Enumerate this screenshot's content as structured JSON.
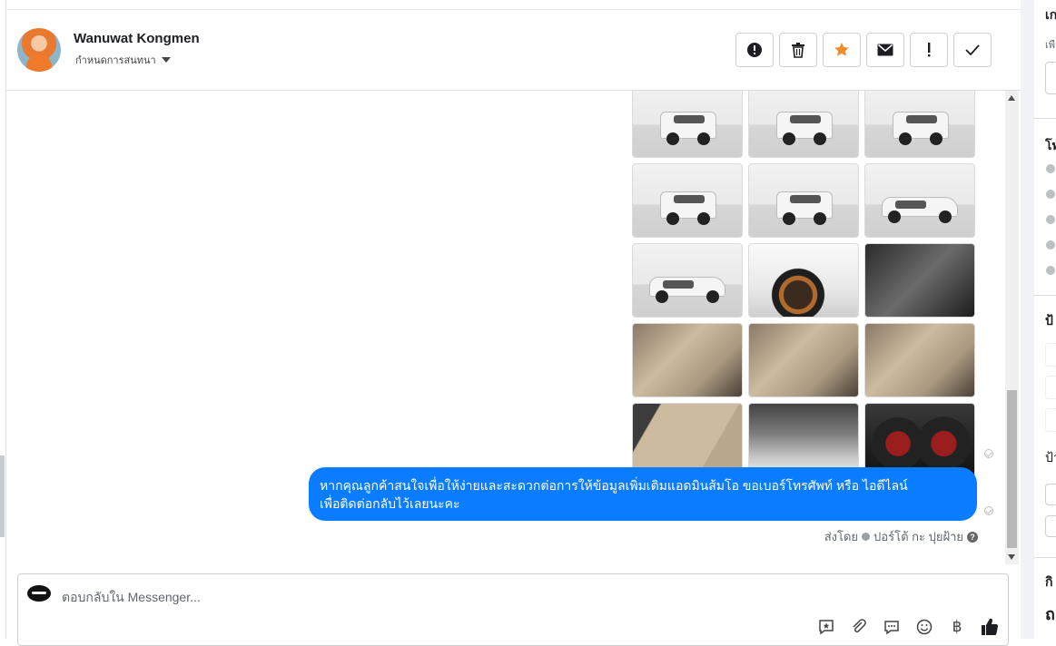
{
  "header": {
    "name": "Wanuwat Kongmen",
    "subtitle": "กำหนดการสนทนา",
    "actions": [
      {
        "name": "spam-button",
        "icon": "alert-circle-icon"
      },
      {
        "name": "delete-button",
        "icon": "trash-icon"
      },
      {
        "name": "star-button",
        "icon": "star-icon",
        "color": "#f28c28"
      },
      {
        "name": "mark-unread-button",
        "icon": "envelope-icon"
      },
      {
        "name": "important-button",
        "icon": "exclamation-icon"
      },
      {
        "name": "done-button",
        "icon": "checkmark-icon"
      }
    ]
  },
  "photos": [
    "showroom",
    "showroom",
    "showroom",
    "showroom",
    "showroom",
    "showroom",
    "showroom-side",
    "wheel",
    "dark",
    "interior",
    "interior",
    "interior",
    "door",
    "engine",
    "gauge"
  ],
  "message": {
    "text_line1": "หากคุณลูกค้าสนใจเพื่อให้ง่ายและสะดวกต่อการให้ข้อมูลเพิ่มเติมแอดมินส้มโอ ขอเบอร์โทรศัพท์ หรือ ไอดีไลน์",
    "text_line2": "เพื่อติดต่อกลับไว้เลยนะคะ",
    "bubble_color": "#0a7cff",
    "sent_by_prefix": "ส่งโดย",
    "sent_by_name": "ปอร์โต้ กะ ปุยฝ้าย"
  },
  "composer": {
    "placeholder": "ตอบกลับใน Messenger...",
    "tools": [
      "saved-reply-icon",
      "attachment-icon",
      "chat-bubble-icon",
      "emoji-icon",
      "baht-icon",
      "like-icon"
    ],
    "baht_symbol": "฿"
  },
  "right_panel": {
    "fragments": [
      "เก",
      "เพื",
      "โท",
      "ป้",
      "ป้า",
      "กิ",
      "ถ"
    ]
  }
}
